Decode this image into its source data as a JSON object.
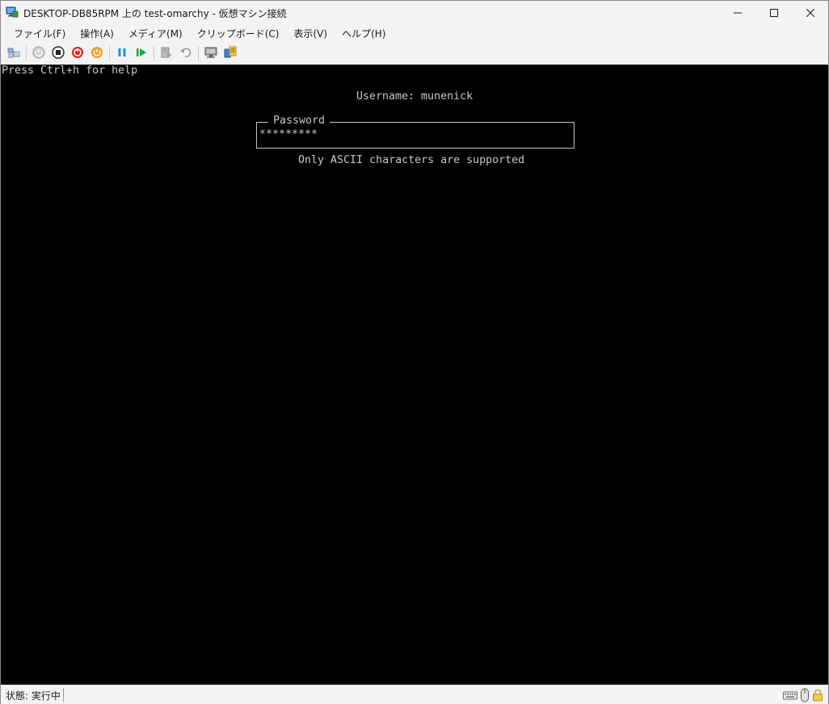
{
  "window": {
    "title": "DESKTOP-DB85RPM 上の test-omarchy - 仮想マシン接続"
  },
  "menu": {
    "items": [
      {
        "label": "ファイル(F)"
      },
      {
        "label": "操作(A)"
      },
      {
        "label": "メディア(M)"
      },
      {
        "label": "クリップボード(C)"
      },
      {
        "label": "表示(V)"
      },
      {
        "label": "ヘルプ(H)"
      }
    ]
  },
  "toolbar": {
    "icons": [
      "ctrl-alt-del-icon",
      "start-icon",
      "turn-off-icon",
      "shutdown-icon",
      "save-icon",
      "pause-icon",
      "resume-icon",
      "checkpoint-icon",
      "revert-icon",
      "enhanced-session-icon",
      "share-icon"
    ]
  },
  "console": {
    "help_text": "Press Ctrl+h for help",
    "username_line": "Username: munenick",
    "password_label": "Password",
    "password_value": "*********",
    "note": "Only ASCII characters are supported"
  },
  "status": {
    "text": "状態: 実行中"
  },
  "colors": {
    "console_bg": "#000000",
    "console_fg": "#c7c7c7",
    "chrome_bg": "#f3f3f3"
  }
}
